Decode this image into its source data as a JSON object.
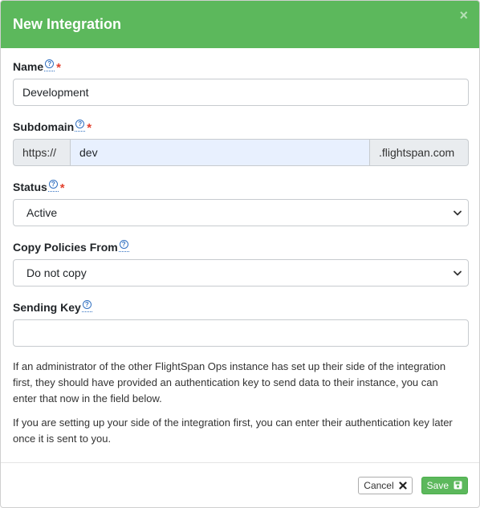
{
  "modal": {
    "title": "New Integration",
    "close_glyph": "×"
  },
  "fields": {
    "name": {
      "label": "Name",
      "value": "Development",
      "required_mark": "*"
    },
    "subdomain": {
      "label": "Subdomain",
      "prefix": "https://",
      "value": "dev",
      "suffix": ".flightspan.com",
      "required_mark": "*"
    },
    "status": {
      "label": "Status",
      "selected": "Active",
      "required_mark": "*"
    },
    "copy_policies": {
      "label": "Copy Policies From",
      "selected": "Do not copy"
    },
    "sending_key": {
      "label": "Sending Key",
      "value": ""
    }
  },
  "help_glyph": "?",
  "help_texts": [
    "If an administrator of the other FlightSpan Ops instance has set up their side of the integration first, they should have provided an authentication key to send data to their instance, you can enter that now in the field below.",
    "If you are setting up your side of the integration first, you can enter their authentication key later once it is sent to you."
  ],
  "footer": {
    "cancel_label": "Cancel",
    "cancel_icon": "x-icon",
    "save_label": "Save",
    "save_icon": "floppy-disk-icon"
  },
  "colors": {
    "header": "#5cb85c",
    "required": "#e2402d",
    "help_icon": "#2f6fc0",
    "autofill_bg": "#e8f0fe"
  }
}
